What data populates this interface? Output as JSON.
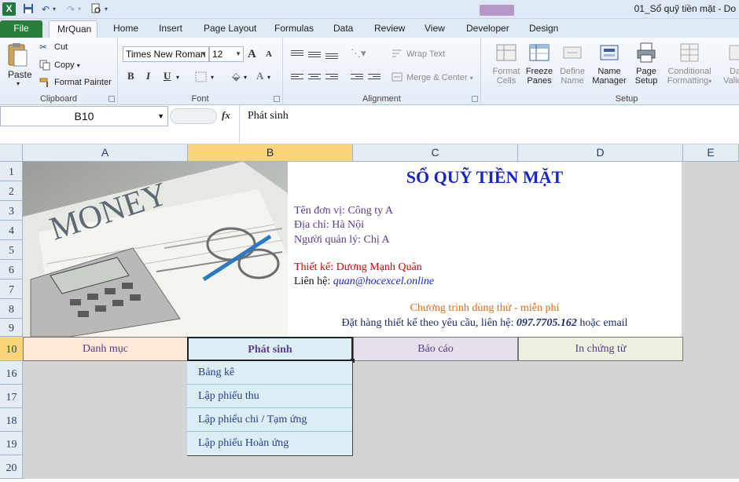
{
  "window": {
    "title": "01_Sổ quỹ tiền mặt - Do",
    "app_icon": "X"
  },
  "tabs": [
    {
      "label": "File"
    },
    {
      "label": "MrQuan"
    },
    {
      "label": "Home"
    },
    {
      "label": "Insert"
    },
    {
      "label": "Page Layout"
    },
    {
      "label": "Formulas"
    },
    {
      "label": "Data"
    },
    {
      "label": "Review"
    },
    {
      "label": "View"
    },
    {
      "label": "Developer"
    },
    {
      "label": "Design"
    }
  ],
  "ribbon": {
    "clipboard": {
      "label": "Clipboard",
      "paste": "Paste",
      "cut": "Cut",
      "copy": "Copy",
      "format_painter": "Format Painter"
    },
    "font": {
      "label": "Font",
      "font_name": "Times New Roman",
      "font_size": "12",
      "bold": "B",
      "italic": "I",
      "underline": "U",
      "grow": "A",
      "shrink": "A"
    },
    "alignment": {
      "label": "Alignment",
      "wrap_text": "Wrap Text",
      "merge_center": "Merge & Center"
    },
    "setup": {
      "label": "Setup",
      "format_cells": [
        "Format",
        "Cells"
      ],
      "freeze_panes": [
        "Freeze",
        "Panes"
      ],
      "define_name": [
        "Define",
        "Name"
      ],
      "name_manager": [
        "Name",
        "Manager"
      ],
      "page_setup": [
        "Page",
        "Setup"
      ],
      "conditional": [
        "Conditional",
        "Formatting"
      ],
      "data_valid": [
        "Da",
        "Valid"
      ]
    }
  },
  "formula_bar": {
    "name_box": "B10",
    "fx": "fx",
    "content": "Phát sinh"
  },
  "columns": [
    "A",
    "B",
    "C",
    "D",
    "E"
  ],
  "rows": [
    "1",
    "2",
    "3",
    "4",
    "5",
    "6",
    "7",
    "8",
    "9",
    "10",
    "16",
    "17",
    "18",
    "19",
    "20"
  ],
  "sheet": {
    "picture_text": "MONEY",
    "title": "SỔ QUỸ TIỀN MẶT",
    "unit": "Tên đơn vị:  Công ty A",
    "address": "Địa chỉ:  Hà Nội",
    "manager": "Người quản lý:  Chị A",
    "designer": "Thiết  kế: Dương Mạnh Quân",
    "contact_label": "Liên hệ:",
    "contact_email": "quan@hocexcel.online",
    "trial": "Chương  trình  dùng  thử  -  miễn  phí",
    "order_prefix": "Đặt hàng  thiết  kế theo yêu cầu,  liên  hệ:",
    "order_phone": "097.7705.162",
    "order_suffix": "hoặc email",
    "nav": [
      "Danh mục",
      "Phát sinh",
      "Báo cáo",
      "In chứng từ"
    ],
    "menu": [
      "Bảng kê",
      "Lập phiếu thu",
      "Lập phiếu chi / Tạm ứng",
      "Lập phiếu Hoàn ứng"
    ]
  }
}
